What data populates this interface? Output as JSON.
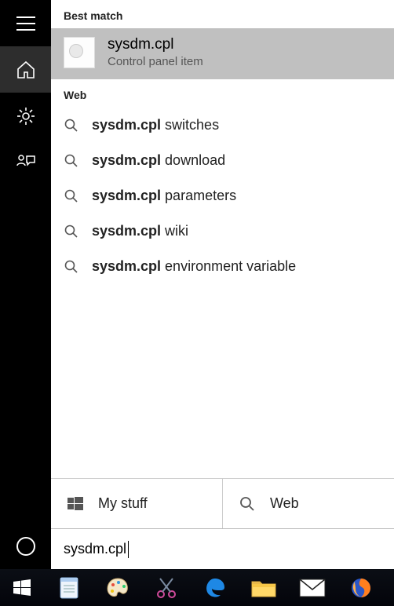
{
  "sections": {
    "best_match_header": "Best match",
    "web_header": "Web"
  },
  "best_match": {
    "title": "sysdm.cpl",
    "subtitle": "Control panel item"
  },
  "web_results": {
    "bold": "sysdm.cpl",
    "items": [
      " switches",
      " download",
      " parameters",
      " wiki",
      " environment variable"
    ]
  },
  "bottom_tabs": {
    "mystuff": "My stuff",
    "web": "Web"
  },
  "search": {
    "value": "sysdm.cpl"
  },
  "taskbar": {
    "items": [
      "notepad",
      "paint",
      "snip",
      "edge",
      "file-explorer",
      "mail",
      "firefox"
    ]
  }
}
